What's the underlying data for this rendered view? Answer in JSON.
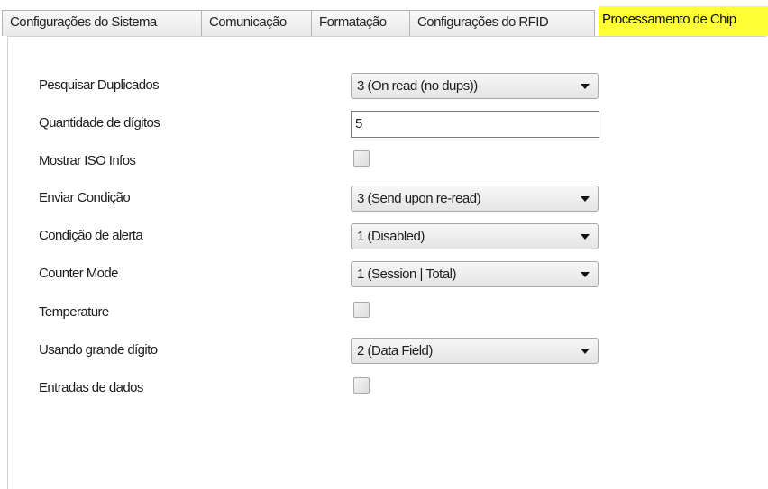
{
  "tabs": [
    {
      "label": "Configurações do Sistema",
      "active": false
    },
    {
      "label": "Comunicação",
      "active": false
    },
    {
      "label": "Formatação",
      "active": false
    },
    {
      "label": "Configurações do RFID",
      "active": false
    },
    {
      "label": "Processamento de Chip",
      "active": true
    }
  ],
  "colors": {
    "active_tab_highlight": "#ffff33",
    "panel_background": "#ffffff"
  },
  "settings": {
    "search_duplicates": {
      "label": "Pesquisar Duplicados",
      "value": "3 (On read (no dups))"
    },
    "digit_count": {
      "label": "Quantidade de dígitos",
      "value": "5"
    },
    "show_iso_info": {
      "label": "Mostrar ISO Infos",
      "checked": false
    },
    "send_condition": {
      "label": "Enviar Condição",
      "value": "3 (Send upon re-read)"
    },
    "alert_condition": {
      "label": "Condição de alerta",
      "value": "1 (Disabled)"
    },
    "counter_mode": {
      "label": "Counter Mode",
      "value": "1 (Session | Total)"
    },
    "temperature": {
      "label": "Temperature",
      "checked": false
    },
    "large_digit": {
      "label": "Usando grande dígito",
      "value": "2 (Data Field)"
    },
    "data_inputs": {
      "label": "Entradas de dados",
      "checked": false
    }
  },
  "icons": {
    "combo_arrow": "chevron-down-icon"
  }
}
